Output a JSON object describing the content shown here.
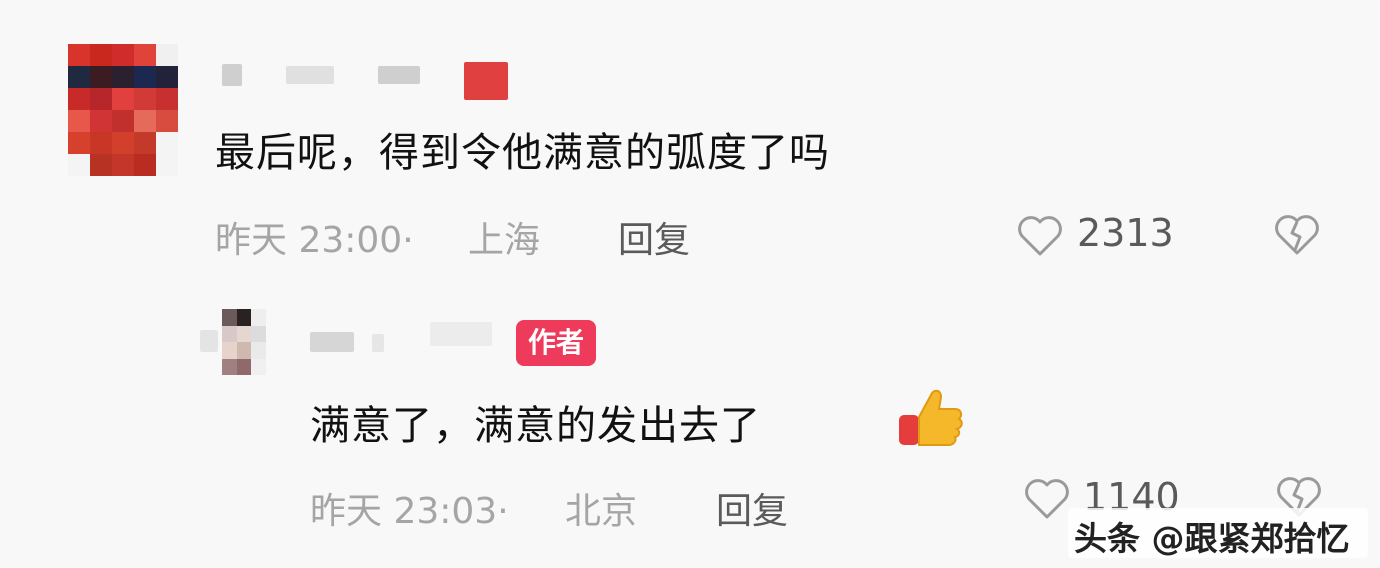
{
  "comments": [
    {
      "text": "最后呢，得到令他满意的弧度了吗",
      "time": "昨天 23:00·",
      "location": "上海",
      "reply_label": "回复",
      "likes": "2313"
    },
    {
      "text": "满意了，满意的发出去了",
      "author_badge": "作者",
      "time": "昨天 23:03·",
      "location": "北京",
      "reply_label": "回复",
      "likes": "1140"
    }
  ],
  "watermark": "头条 @跟紧郑拾忆",
  "icons": {
    "like": "heart-outline-icon",
    "dislike": "broken-heart-icon",
    "emoji": "thumbs-up-emoji"
  },
  "colors": {
    "badge": "#ee3b5c",
    "text": "#111111",
    "meta": "#a5a5a5"
  }
}
